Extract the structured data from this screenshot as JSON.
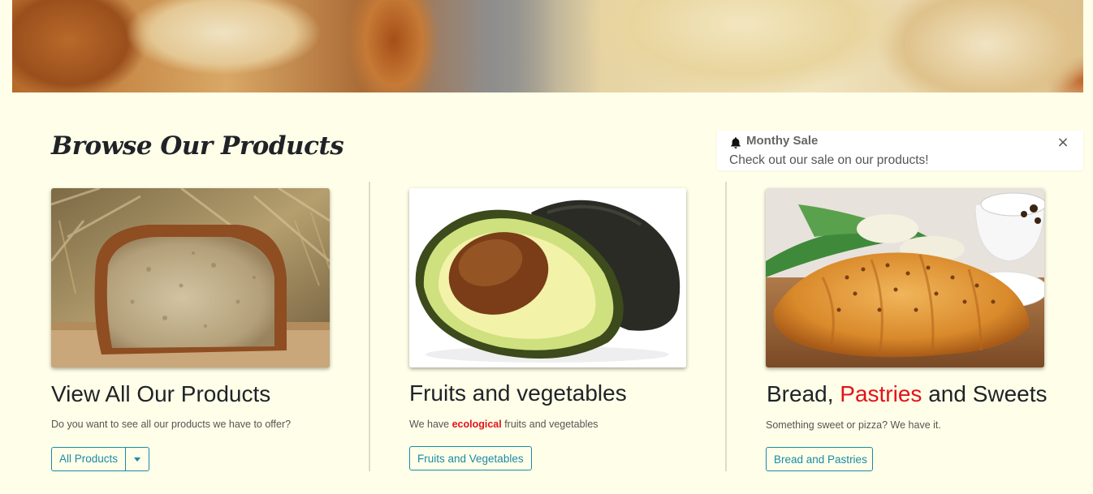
{
  "hero": {
    "alt": "bread banner"
  },
  "page": {
    "heading": "Browse Our Products"
  },
  "toast": {
    "title": "Monthy Sale",
    "body": "Check out our sale on our products!",
    "close": "×",
    "icon": "bell-icon"
  },
  "cards": [
    {
      "title": "View All Our Products",
      "text": "Do you want to see all our products we have to offer?",
      "button": "All Products",
      "image": "bread-loaf-image"
    },
    {
      "title": "Fruits and vegetables",
      "text_before": "We have ",
      "text_highlight": "ecological",
      "text_after": " fruits and vegetables",
      "button": "Fruits and Vegetables",
      "image": "avocado-image"
    },
    {
      "title_before": "Bread, ",
      "title_highlight": "Pastries",
      "title_after": " and Sweets",
      "text": "Something sweet or pizza? We have it.",
      "button": "Bread and Pastries",
      "image": "croissant-image"
    }
  ],
  "colors": {
    "background": "#fffee8",
    "accent": "#1a8aa8",
    "highlight": "#e3121b"
  }
}
